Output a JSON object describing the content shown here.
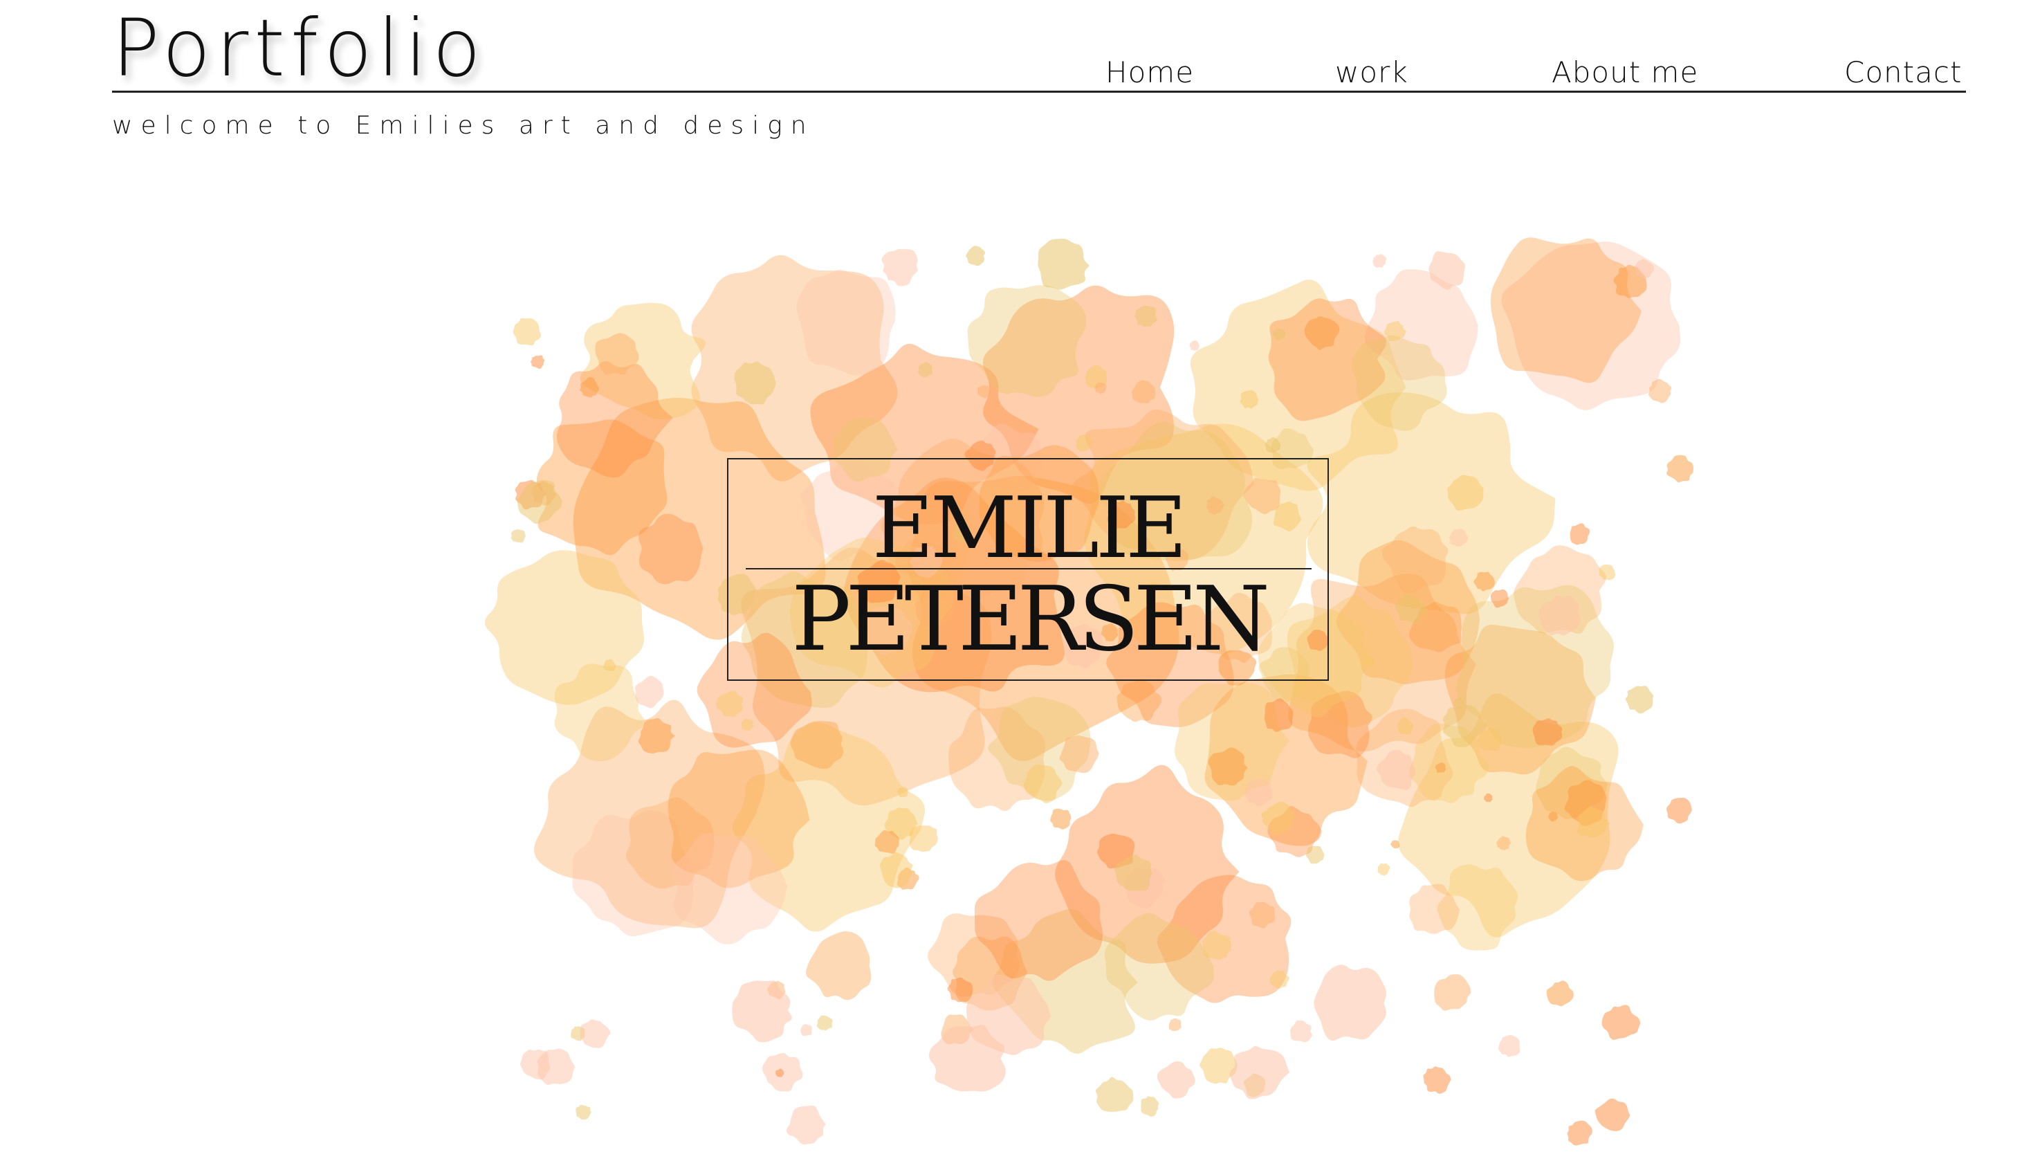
{
  "header": {
    "title": "Portfolio",
    "tagline": "welcome to Emilies art and design"
  },
  "nav": {
    "items": [
      {
        "label": "Home"
      },
      {
        "label": "work"
      },
      {
        "label": "About me"
      },
      {
        "label": "Contact"
      }
    ]
  },
  "hero": {
    "name_first": "EMILIE",
    "name_last": "PETERSEN",
    "palette": [
      "#fc9a3c",
      "#fdb069",
      "#f7c868",
      "#fec4a8",
      "#fe8a3a",
      "#e9c46a"
    ]
  }
}
